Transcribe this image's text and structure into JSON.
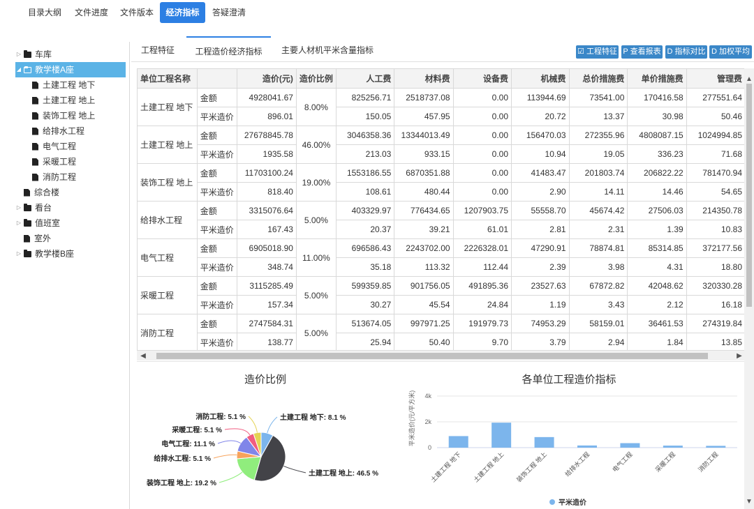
{
  "top_tabs": [
    "目录大纲",
    "文件进度",
    "文件版本",
    "经济指标",
    "答疑澄清"
  ],
  "sidebar": {
    "items": [
      {
        "label": "车库",
        "icon": "folder-icon",
        "caret": "▷",
        "level": 0
      },
      {
        "label": "教学楼A座",
        "icon": "folder-open-icon",
        "caret": "◢",
        "level": 0,
        "selected": true
      },
      {
        "label": "土建工程 地下",
        "icon": "file-icon",
        "level": 1
      },
      {
        "label": "土建工程 地上",
        "icon": "file-icon",
        "level": 1
      },
      {
        "label": "装饰工程 地上",
        "icon": "file-icon",
        "level": 1
      },
      {
        "label": "给排水工程",
        "icon": "file-icon",
        "level": 1
      },
      {
        "label": "电气工程",
        "icon": "file-icon",
        "level": 1
      },
      {
        "label": "采暖工程",
        "icon": "file-icon",
        "level": 1
      },
      {
        "label": "消防工程",
        "icon": "file-icon",
        "level": 1
      },
      {
        "label": "综合楼",
        "icon": "file-icon",
        "level": 0
      },
      {
        "label": "看台",
        "icon": "folder-icon",
        "caret": "▷",
        "level": 0
      },
      {
        "label": "值班室",
        "icon": "folder-icon",
        "caret": "▷",
        "level": 0
      },
      {
        "label": "室外",
        "icon": "file-icon",
        "level": 0
      },
      {
        "label": "教学楼B座",
        "icon": "folder-icon",
        "caret": "▷",
        "level": 0
      }
    ]
  },
  "sub_tabs": [
    "工程特征",
    "工程造价经济指标",
    "主要人材机平米含量指标"
  ],
  "buttons": [
    "☑ 工程特征",
    "P 查看报表",
    "D 指标对比",
    "D 加权平均"
  ],
  "table": {
    "headers": [
      "单位工程名称",
      "",
      "造价(元)",
      "造价比例",
      "人工费",
      "材料费",
      "设备费",
      "机械费",
      "总价措施费",
      "单价措施费",
      "管理费"
    ],
    "row_labels": [
      "金额",
      "平米造价"
    ],
    "groups": [
      {
        "name": "土建工程 地下",
        "ratio": "8.00%",
        "amount": [
          "4928041.67",
          "825256.71",
          "2518737.08",
          "0.00",
          "113944.69",
          "73541.00",
          "170416.58",
          "277551.64"
        ],
        "per_sqm": [
          "896.01",
          "150.05",
          "457.95",
          "0.00",
          "20.72",
          "13.37",
          "30.98",
          "50.46"
        ]
      },
      {
        "name": "土建工程 地上",
        "ratio": "46.00%",
        "amount": [
          "27678845.78",
          "3046358.36",
          "13344013.49",
          "0.00",
          "156470.03",
          "272355.96",
          "4808087.15",
          "1024994.85"
        ],
        "per_sqm": [
          "1935.58",
          "213.03",
          "933.15",
          "0.00",
          "10.94",
          "19.05",
          "336.23",
          "71.68"
        ]
      },
      {
        "name": "装饰工程 地上",
        "ratio": "19.00%",
        "amount": [
          "11703100.24",
          "1553186.55",
          "6870351.88",
          "0.00",
          "41483.47",
          "201803.74",
          "206822.22",
          "781470.94"
        ],
        "per_sqm": [
          "818.40",
          "108.61",
          "480.44",
          "0.00",
          "2.90",
          "14.11",
          "14.46",
          "54.65"
        ]
      },
      {
        "name": "给排水工程",
        "ratio": "5.00%",
        "amount": [
          "3315076.64",
          "403329.97",
          "776434.65",
          "1207903.75",
          "55558.70",
          "45674.42",
          "27506.03",
          "214350.78"
        ],
        "per_sqm": [
          "167.43",
          "20.37",
          "39.21",
          "61.01",
          "2.81",
          "2.31",
          "1.39",
          "10.83"
        ]
      },
      {
        "name": "电气工程",
        "ratio": "11.00%",
        "amount": [
          "6905018.90",
          "696586.43",
          "2243702.00",
          "2226328.01",
          "47290.91",
          "78874.81",
          "85314.85",
          "372177.56"
        ],
        "per_sqm": [
          "348.74",
          "35.18",
          "113.32",
          "112.44",
          "2.39",
          "3.98",
          "4.31",
          "18.80"
        ]
      },
      {
        "name": "采暖工程",
        "ratio": "5.00%",
        "amount": [
          "3115285.49",
          "599359.85",
          "901756.05",
          "491895.36",
          "23527.63",
          "67872.82",
          "42048.62",
          "320330.28"
        ],
        "per_sqm": [
          "157.34",
          "30.27",
          "45.54",
          "24.84",
          "1.19",
          "3.43",
          "2.12",
          "16.18"
        ]
      },
      {
        "name": "消防工程",
        "ratio": "5.00%",
        "amount": [
          "2747584.31",
          "513674.05",
          "997971.25",
          "191979.73",
          "74953.29",
          "58159.01",
          "36461.53",
          "274319.84"
        ],
        "per_sqm": [
          "138.77",
          "25.94",
          "50.40",
          "9.70",
          "3.79",
          "2.94",
          "1.84",
          "13.85"
        ]
      }
    ]
  },
  "chart_data": [
    {
      "type": "pie",
      "title": "造价比例",
      "slices": [
        {
          "label": "土建工程 地下: 8.1 %",
          "value": 8.1,
          "color": "#7cb5ec"
        },
        {
          "label": "土建工程 地上: 46.5 %",
          "value": 46.5,
          "color": "#434348"
        },
        {
          "label": "装饰工程 地上: 19.2 %",
          "value": 19.2,
          "color": "#90ed7d"
        },
        {
          "label": "给排水工程: 5.1 %",
          "value": 5.1,
          "color": "#f7a35c"
        },
        {
          "label": "电气工程: 11.1 %",
          "value": 11.1,
          "color": "#8085e9"
        },
        {
          "label": "采暖工程: 5.1 %",
          "value": 5.1,
          "color": "#f15c80"
        },
        {
          "label": "消防工程: 5.1 %",
          "value": 5.1,
          "color": "#e4d354"
        }
      ]
    },
    {
      "type": "bar",
      "title": "各单位工程造价指标",
      "ylabel": "平米造价(元/平方米)",
      "yticks": [
        "0",
        "2k",
        "4k"
      ],
      "ylim": [
        0,
        4000
      ],
      "categories": [
        "土建工程 地下",
        "土建工程 地上",
        "装饰工程 地上",
        "给排水工程",
        "电气工程",
        "采暖工程",
        "消防工程"
      ],
      "series": [
        {
          "name": "平米造价",
          "values": [
            896.01,
            1935.58,
            818.4,
            167.43,
            348.74,
            157.34,
            138.77
          ],
          "color": "#7cb5ec"
        }
      ]
    }
  ],
  "colors": {
    "accent": "#2c7fe3",
    "selected": "#5bb3e6",
    "button": "#3a87c8"
  }
}
